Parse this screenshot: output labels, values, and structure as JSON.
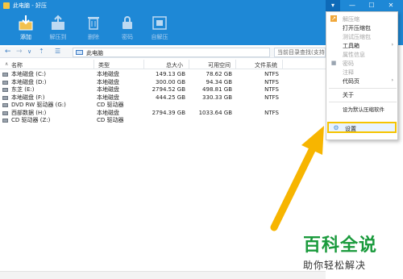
{
  "window": {
    "title": "此电脑 - 好压",
    "controls": {
      "menu": "▾",
      "minimize": "—",
      "maximize": "☐",
      "close": "✕"
    }
  },
  "toolbar": {
    "buttons": [
      {
        "label": "添加",
        "icon": "add-archive-icon",
        "enabled": true
      },
      {
        "label": "解压到",
        "icon": "extract-to-icon",
        "enabled": false
      },
      {
        "label": "删除",
        "icon": "trash-icon",
        "enabled": false
      },
      {
        "label": "密码",
        "icon": "lock-icon",
        "enabled": false
      },
      {
        "label": "自解压",
        "icon": "self-extract-icon",
        "enabled": false
      }
    ]
  },
  "address": {
    "back": "←",
    "forward": "→",
    "dropdown": "∨",
    "path": "此电脑",
    "search_placeholder": "当前目录查找(支持模糊"
  },
  "table": {
    "headers": {
      "name": "名称",
      "type": "类型",
      "total": "总大小",
      "free": "可用空间",
      "fs": "文件系统"
    },
    "rows": [
      {
        "name": "本地磁盘 (C:)",
        "type": "本地磁盘",
        "total": "149.13 GB",
        "free": "78.62 GB",
        "fs": "NTFS"
      },
      {
        "name": "本地磁盘 (D:)",
        "type": "本地磁盘",
        "total": "300.00 GB",
        "free": "94.34 GB",
        "fs": "NTFS"
      },
      {
        "name": "东芝 (E:)",
        "type": "本地磁盘",
        "total": "2794.52 GB",
        "free": "498.81 GB",
        "fs": "NTFS"
      },
      {
        "name": "本地磁盘 (F:)",
        "type": "本地磁盘",
        "total": "444.25 GB",
        "free": "330.33 GB",
        "fs": "NTFS"
      },
      {
        "name": "DVD RW 驱动器 (G:)",
        "type": "CD 驱动器",
        "total": "",
        "free": "",
        "fs": ""
      },
      {
        "name": "西部数据 (H:)",
        "type": "本地磁盘",
        "total": "2794.39 GB",
        "free": "1033.64 GB",
        "fs": "NTFS"
      },
      {
        "name": "CD 驱动器 (Z:)",
        "type": "CD 驱动器",
        "total": "",
        "free": "",
        "fs": ""
      }
    ]
  },
  "menu": {
    "items": [
      {
        "label": "解压缩",
        "enabled": false,
        "icon": "extract-icon"
      },
      {
        "label": "打开压缩包",
        "enabled": true
      },
      {
        "label": "测试压缩包",
        "enabled": false
      },
      {
        "label": "工具箱",
        "enabled": true,
        "submenu": true
      },
      {
        "label": "属性信息",
        "enabled": false
      },
      {
        "label": "密码",
        "enabled": false,
        "icon": "lock-icon"
      },
      {
        "label": "注释",
        "enabled": false
      },
      {
        "label": "代码页",
        "enabled": true,
        "submenu": true
      },
      {
        "label": "关于",
        "enabled": true
      },
      {
        "label": "设为默认压缩软件",
        "enabled": true
      },
      {
        "label": "设置",
        "enabled": true,
        "icon": "gear-icon",
        "highlighted": true
      }
    ]
  },
  "watermark": {
    "title": "百科全说",
    "subtitle": "助你轻松解决"
  },
  "colors": {
    "toolbar_blue": "#1e88d6",
    "highlight_border": "#f6c400",
    "arrow": "#f7b500",
    "watermark_green": "#1a9a3c"
  }
}
